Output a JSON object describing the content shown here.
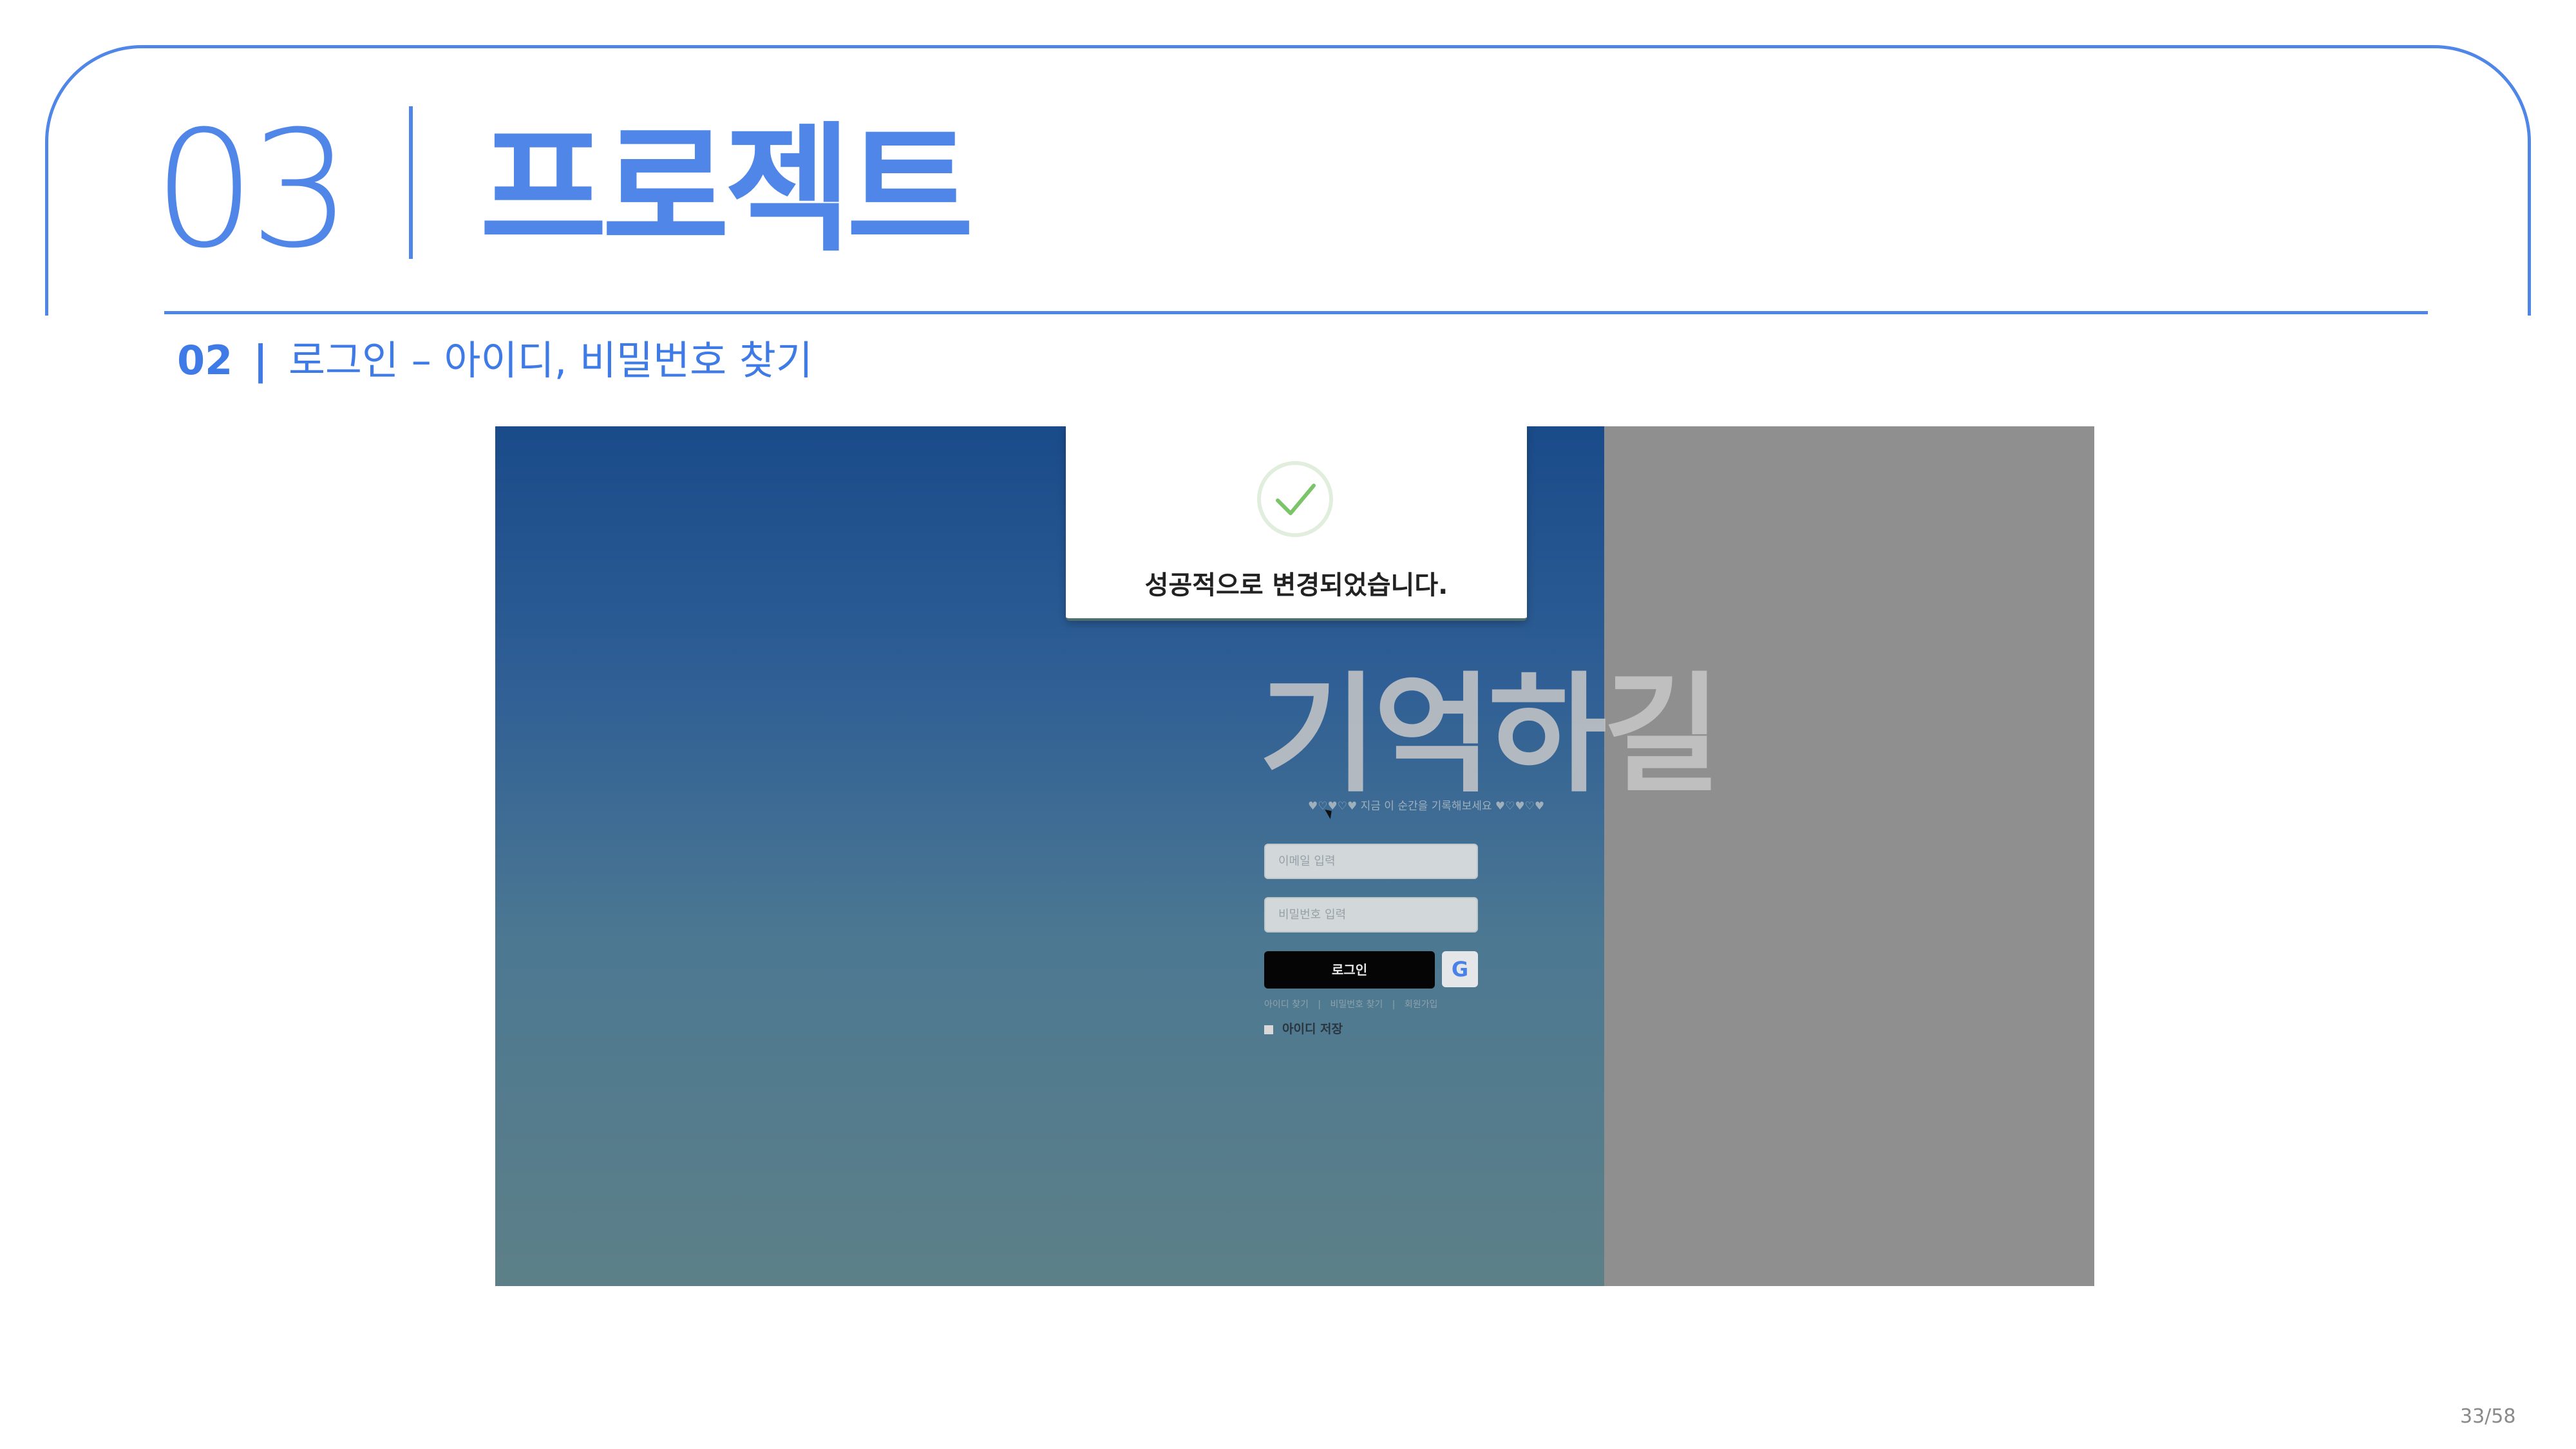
{
  "header": {
    "section_number": "03",
    "section_title": "프로젝트"
  },
  "subtitle": {
    "number": "02",
    "separator": "|",
    "text": "로그인 – 아이디, 비밀번호 찾기"
  },
  "screenshot": {
    "logo_text": "기억하길",
    "tagline": "♥♡♥♡♥ 지금 이 순간을 기록해보세요 ♥♡♥♡♥",
    "email_placeholder": "이메일 입력",
    "password_placeholder": "비밀번호 입력",
    "login_label": "로그인",
    "google_label": "G",
    "links": [
      "아이디 찾기",
      "|",
      "비밀번호 찾기",
      "|",
      "회원가입"
    ],
    "remember_label": "아이디 저장",
    "modal": {
      "message": "성공적으로 변경되었습니다."
    }
  },
  "page_indicator": "33/58",
  "colors": {
    "accent": "#4f86e8",
    "check": "#7cc46a"
  }
}
